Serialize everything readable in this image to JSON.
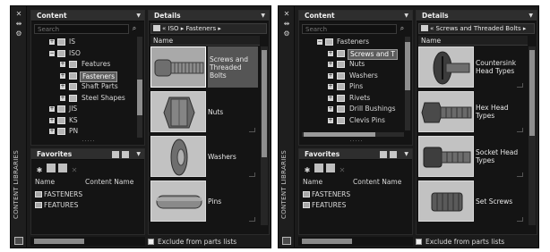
{
  "strip": {
    "close_glyph": "✕",
    "pin_glyph": "⇹",
    "gear_glyph": "⚙",
    "vertical_label": "CONTENT LIBRARIES"
  },
  "panels": [
    {
      "content": {
        "title": "Content",
        "search_placeholder": "Search",
        "tree": [
          {
            "label": "IS",
            "expander": "+",
            "depth": 1
          },
          {
            "label": "ISO",
            "expander": "−",
            "depth": 1
          },
          {
            "label": "Features",
            "expander": "+",
            "depth": 2
          },
          {
            "label": "Fasteners",
            "expander": "+",
            "depth": 2,
            "selected": true
          },
          {
            "label": "Shaft Parts",
            "expander": "+",
            "depth": 2
          },
          {
            "label": "Steel Shapes",
            "expander": "+",
            "depth": 2
          },
          {
            "label": "JIS",
            "expander": "+",
            "depth": 1
          },
          {
            "label": "KS",
            "expander": "+",
            "depth": 1
          },
          {
            "label": "PN",
            "expander": "+",
            "depth": 1
          }
        ]
      },
      "favorites": {
        "title": "Favorites",
        "columns": [
          "Name",
          "Content Name"
        ],
        "items": [
          "FASTENERS",
          "FEATURES"
        ]
      },
      "details": {
        "title": "Details",
        "breadcrumb": "« ISO ▸ Fasteners ▸",
        "column": "Name",
        "items": [
          {
            "label": "Screws and Threaded Bolts",
            "icon": "screw-thumbnail",
            "selected": true
          },
          {
            "label": "Nuts",
            "icon": "nut-thumbnail"
          },
          {
            "label": "Washers",
            "icon": "washer-thumbnail"
          },
          {
            "label": "Pins",
            "icon": "pin-thumbnail"
          }
        ],
        "exclude_label": "Exclude from parts lists"
      }
    },
    {
      "content": {
        "title": "Content",
        "search_placeholder": "Search",
        "tree": [
          {
            "label": "Fasteners",
            "expander": "−",
            "depth": 1
          },
          {
            "label": "Screws and T",
            "expander": "+",
            "depth": 2,
            "selected": true
          },
          {
            "label": "Nuts",
            "expander": "+",
            "depth": 2
          },
          {
            "label": "Washers",
            "expander": "+",
            "depth": 2
          },
          {
            "label": "Pins",
            "expander": "+",
            "depth": 2
          },
          {
            "label": "Rivets",
            "expander": "+",
            "depth": 2
          },
          {
            "label": "Drill Bushings",
            "expander": "+",
            "depth": 2
          },
          {
            "label": "Clevis Pins",
            "expander": "+",
            "depth": 2
          }
        ]
      },
      "favorites": {
        "title": "Favorites",
        "columns": [
          "Name",
          "Content Name"
        ],
        "items": [
          "FASTENERS",
          "FEATURES"
        ]
      },
      "details": {
        "title": "Details",
        "breadcrumb": "« Screws and Threaded Bolts ▸",
        "column": "Name",
        "items": [
          {
            "label": "Countersink Head Types",
            "icon": "countersink-screw-thumbnail"
          },
          {
            "label": "Hex Head Types",
            "icon": "hex-head-bolt-thumbnail"
          },
          {
            "label": "Socket Head Types",
            "icon": "socket-head-screw-thumbnail"
          },
          {
            "label": "Set Screws",
            "icon": "set-screw-thumbnail"
          }
        ],
        "exclude_label": "Exclude from parts lists"
      }
    }
  ]
}
